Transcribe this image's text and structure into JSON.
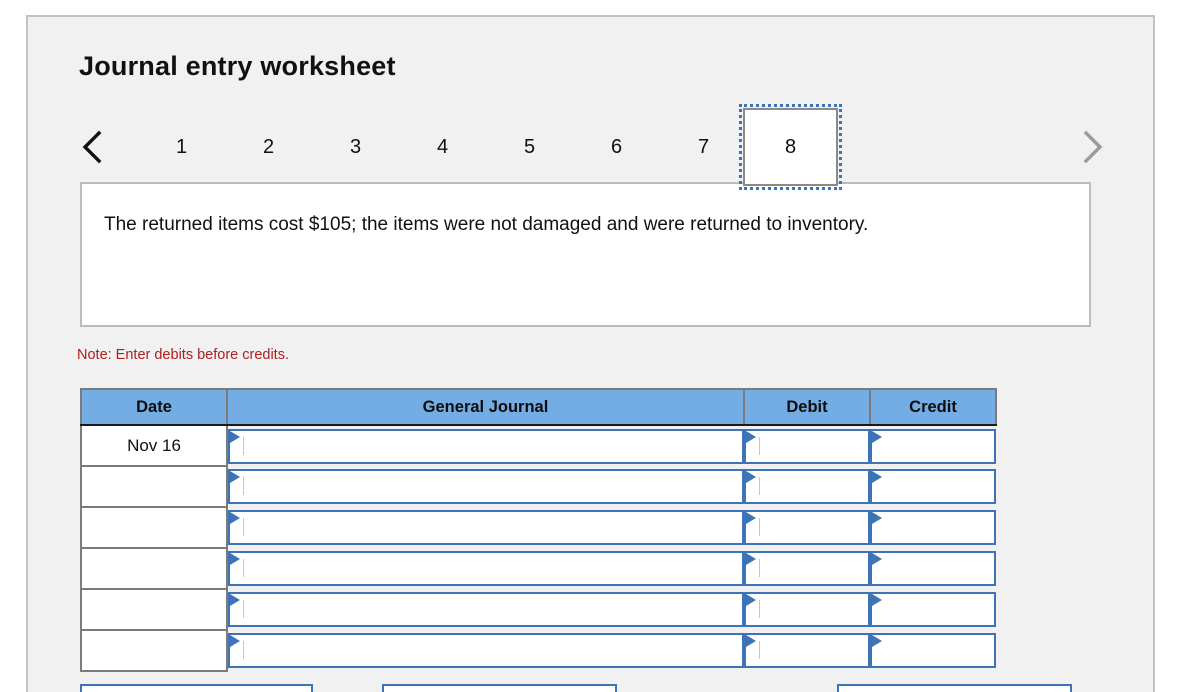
{
  "header": {
    "title": "Journal entry worksheet"
  },
  "pager": {
    "prev_icon": "chevron-left-icon",
    "next_icon": "chevron-right-icon",
    "prev_label": "‹",
    "next_label": "›",
    "pages": [
      "1",
      "2",
      "3",
      "4",
      "5",
      "6",
      "7",
      "8"
    ],
    "active_page": "8",
    "prev_color": "#101010",
    "next_color": "#9b9b9b"
  },
  "description": {
    "text": "The returned items cost $105; the items were not damaged and were returned to inventory."
  },
  "note": {
    "text": "Note: Enter debits before credits.",
    "color": "#ad2020"
  },
  "journal": {
    "columns": [
      "Date",
      "General Journal",
      "Debit",
      "Credit"
    ],
    "header_bg": "#74ade4",
    "input_border": "#3d74b8",
    "rows": [
      {
        "date": "Nov 16",
        "general_journal": "",
        "debit": "",
        "credit": ""
      },
      {
        "date": "",
        "general_journal": "",
        "debit": "",
        "credit": ""
      },
      {
        "date": "",
        "general_journal": "",
        "debit": "",
        "credit": ""
      },
      {
        "date": "",
        "general_journal": "",
        "debit": "",
        "credit": ""
      },
      {
        "date": "",
        "general_journal": "",
        "debit": "",
        "credit": ""
      },
      {
        "date": "",
        "general_journal": "",
        "debit": "",
        "credit": ""
      }
    ]
  },
  "footer_buttons": [
    {
      "name": "record-entry-button"
    },
    {
      "name": "clear-entry-button"
    },
    {
      "name": "view-journal-button"
    }
  ]
}
